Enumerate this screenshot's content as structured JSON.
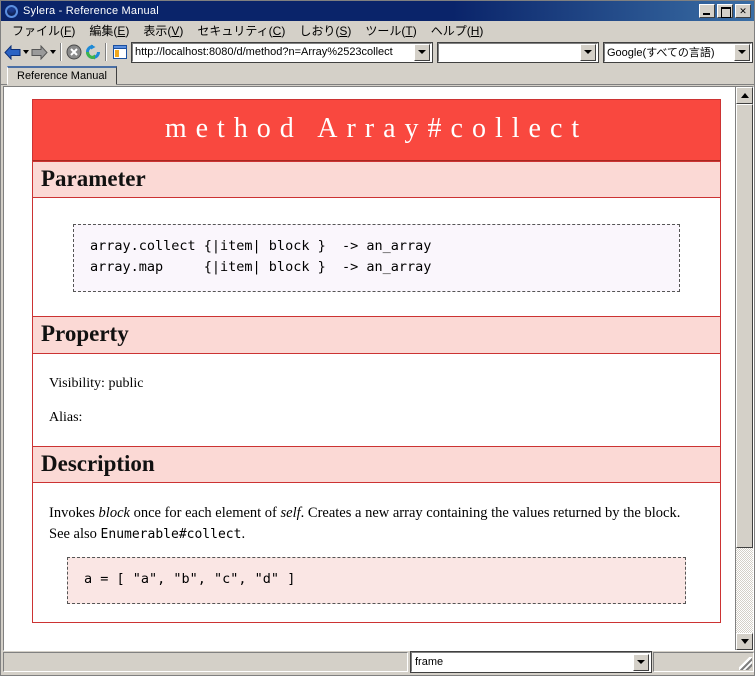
{
  "window": {
    "title": "Sylera - Reference Manual",
    "logo_icon": "sylera-logo-icon",
    "minimize_label": "Minimize",
    "maximize_label": "Maximize",
    "close_label": "✕"
  },
  "menubar": {
    "items": [
      {
        "label": "ファイル(",
        "accel": "F",
        "tail": ")"
      },
      {
        "label": "編集(",
        "accel": "E",
        "tail": ")"
      },
      {
        "label": "表示(",
        "accel": "V",
        "tail": ")"
      },
      {
        "label": "セキュリティ(",
        "accel": "C",
        "tail": ")"
      },
      {
        "label": "しおり(",
        "accel": "S",
        "tail": ")"
      },
      {
        "label": "ツール(",
        "accel": "T",
        "tail": ")"
      },
      {
        "label": "ヘルプ(",
        "accel": "H",
        "tail": ")"
      }
    ]
  },
  "toolbar": {
    "back_icon": "back-arrow-icon",
    "forward_icon": "forward-arrow-icon",
    "stop_icon": "stop-icon",
    "reload_icon": "reload-icon",
    "home_icon": "page-home-icon",
    "address_value": "http://localhost:8080/d/method?n=Array%2523collect",
    "search_value": "",
    "search_placeholder": "",
    "engine_value": "Google(すべての言語)"
  },
  "tabs": [
    {
      "label": "Reference Manual",
      "active": true
    }
  ],
  "document": {
    "title": "method Array#collect",
    "sections": [
      {
        "heading": "Parameter",
        "code": "array.collect {|item| block }  -> an_array\narray.map     {|item| block }  -> an_array"
      },
      {
        "heading": "Property",
        "visibility_line": "Visibility: public",
        "alias_line": "Alias:"
      },
      {
        "heading": "Description",
        "paragraph_pre": "Invokes ",
        "paragraph_em1": "block",
        "paragraph_mid": " once for each element of ",
        "paragraph_em2": "self",
        "paragraph_post": ". Creates a new array containing the values returned by the block. See also ",
        "paragraph_mono": "Enumerable#collect",
        "paragraph_end": ".",
        "code": "a = [ \"a\", \"b\", \"c\", \"d\" ]"
      }
    ]
  },
  "scrollbar": {
    "up_icon": "scroll-up-icon",
    "down_icon": "scroll-down-icon",
    "thumb_label": "vertical-scroll-thumb"
  },
  "statusbar": {
    "message": "",
    "frame_value": "frame",
    "resize_grip": "resize-grip-icon"
  },
  "colors": {
    "title_banner": "#f9483f",
    "section_header": "#fbd9d5",
    "doc_border": "#cc3333",
    "code_bg_lavender": "#faf6fc",
    "code_bg_pink": "#fae6e4",
    "chrome": "#d4d0c8",
    "titlebar": "#0a246a"
  }
}
